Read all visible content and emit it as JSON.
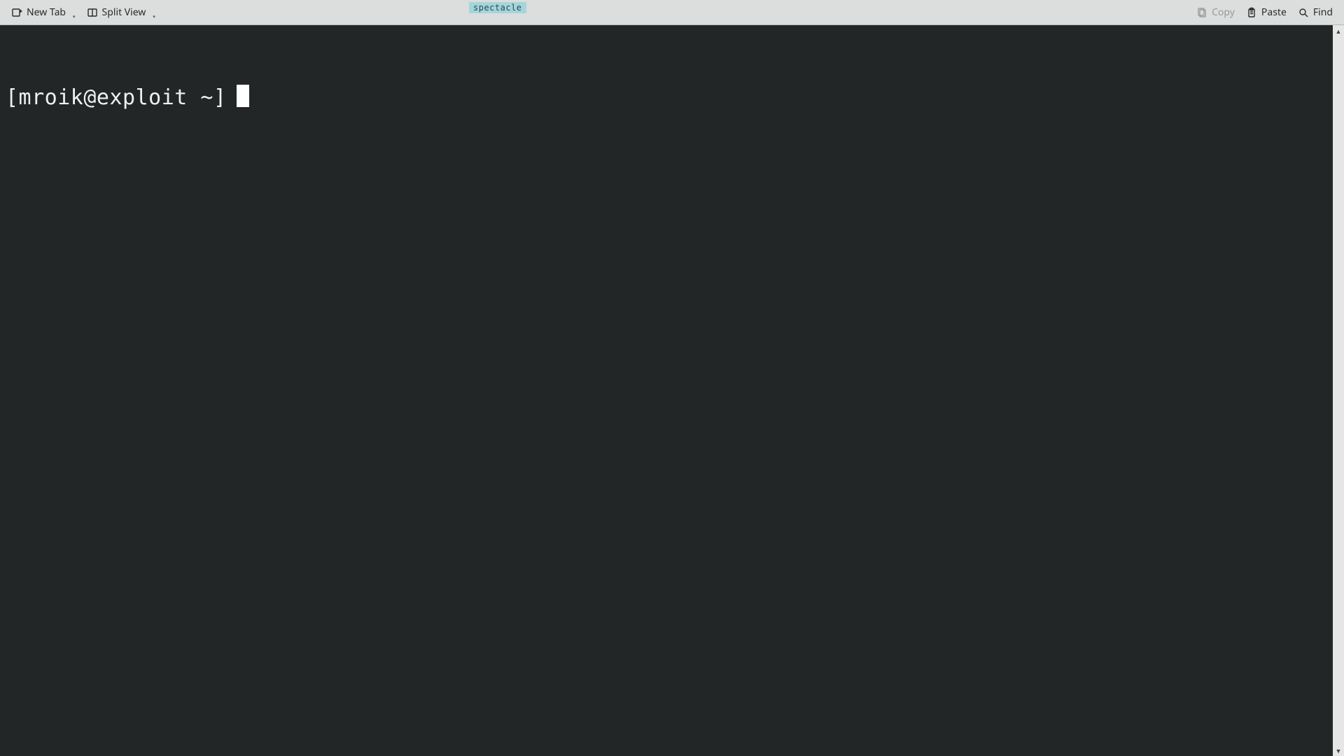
{
  "toolbar": {
    "new_tab_label": "New Tab",
    "split_view_label": "Split View",
    "copy_label": "Copy",
    "paste_label": "Paste",
    "find_label": "Find"
  },
  "title_pill": "spectacle",
  "terminal": {
    "prompt": "[mroik@exploit ~]"
  },
  "colors": {
    "toolbar_bg": "#dcdddd",
    "terminal_bg": "#232627",
    "terminal_fg": "#f0f0f0",
    "pill_bg": "#a5d5dc"
  }
}
